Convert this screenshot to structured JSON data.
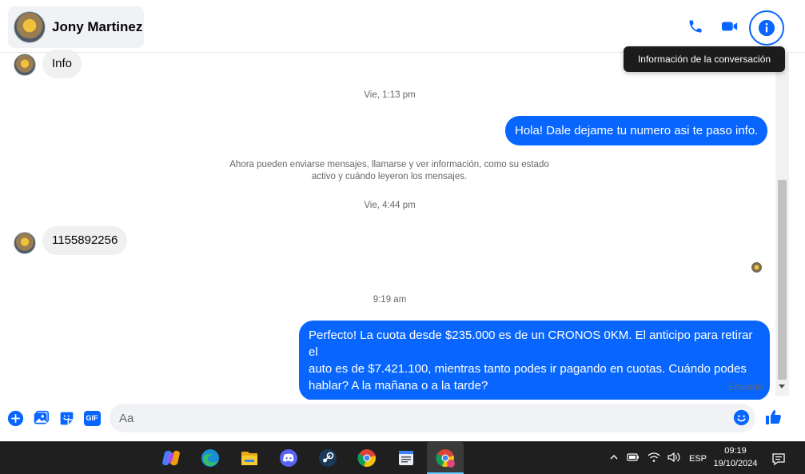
{
  "header": {
    "contact_name": "Jony Martinez",
    "tooltip": "Información de la conversación",
    "accent": "#0866ff"
  },
  "messages": {
    "first_incoming": "Info",
    "ts1": "Vie, 1:13 pm",
    "out1": "Hola! Dale dejame tu numero  asi te paso info.",
    "system_note_line1": "Ahora pueden enviarse mensajes, llamarse y ver información, como su estado",
    "system_note_line2": "activo y cuándo leyeron los mensajes.",
    "ts2": "Vie, 4:44 pm",
    "in2": "1155892256",
    "ts3": "9:19 am",
    "out2_line1": "Perfecto! La cuota desde $235.000 es de un CRONOS 0KM. El anticipo para retirar el",
    "out2_line2": "auto es de $7.421.100, mientras tanto podes ir pagando en cuotas. Cuándo podes",
    "out2_line3": "hablar? A la mañana o a la tarde?",
    "status": "Enviado"
  },
  "composer": {
    "placeholder": "Aa",
    "gif_label": "GIF"
  },
  "taskbar": {
    "language": "ESP",
    "time": "09:19",
    "date": "19/10/2024",
    "apps": [
      "copilot-icon",
      "edge-icon",
      "file-explorer-icon",
      "discord-icon",
      "steam-icon",
      "chrome-icon",
      "notepad-icon",
      "chrome-profile-icon"
    ]
  }
}
